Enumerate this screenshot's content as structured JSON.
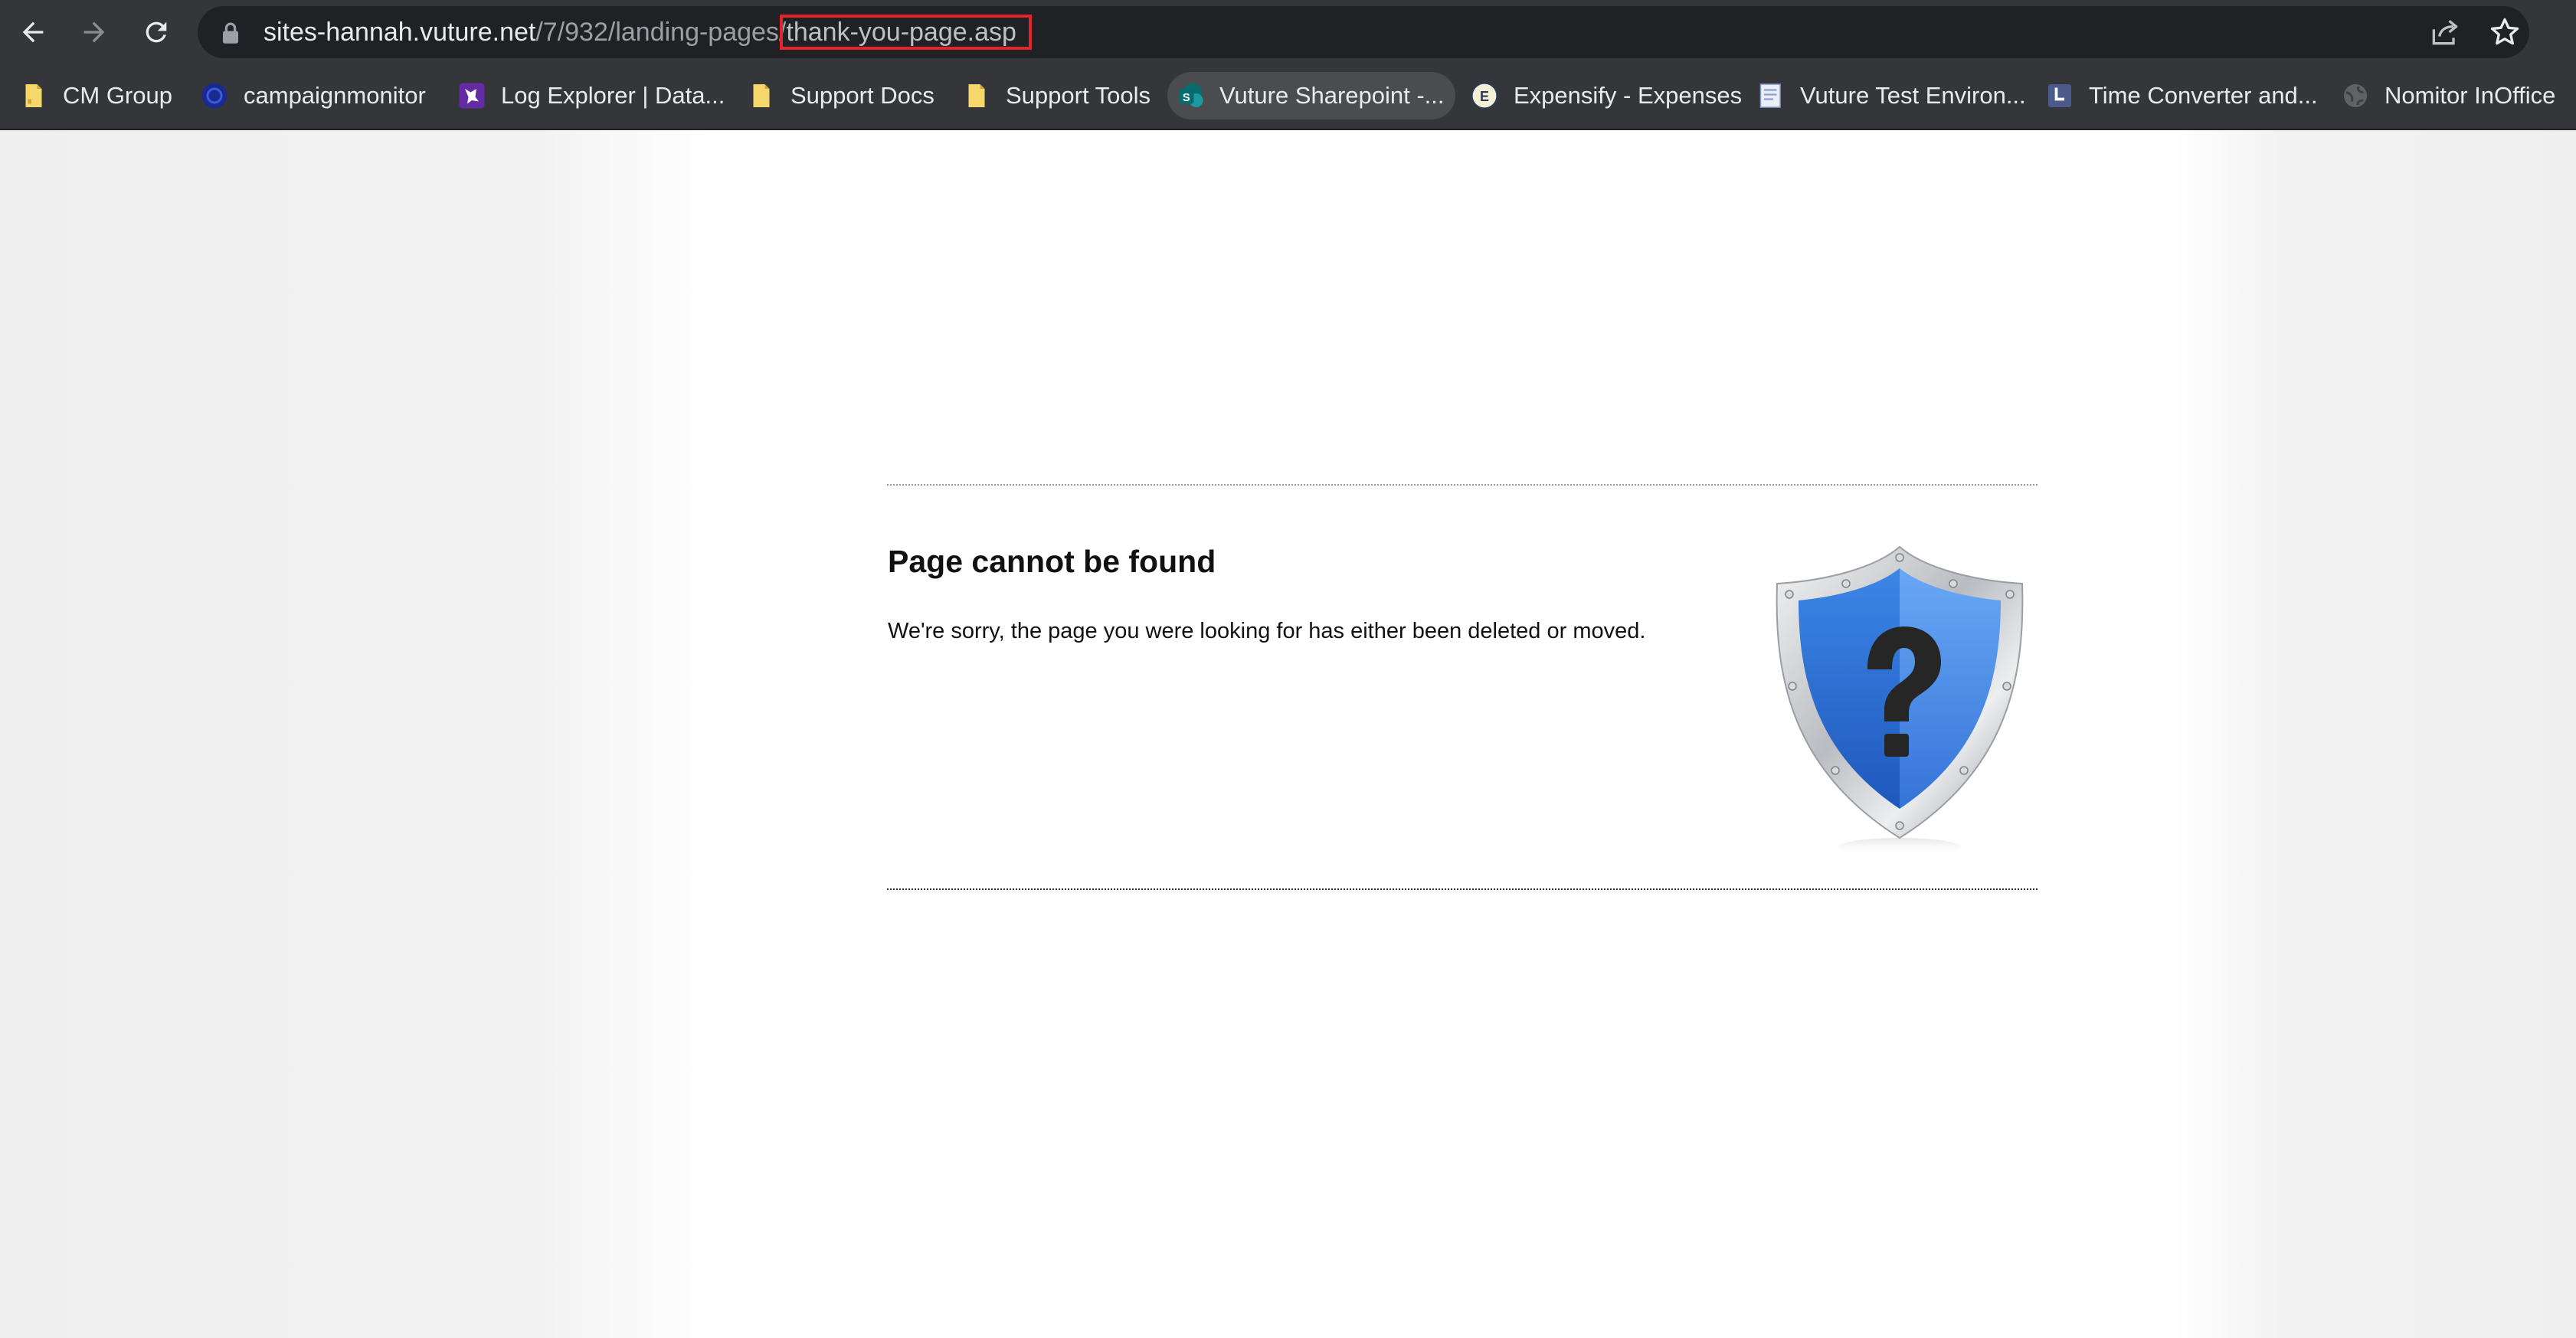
{
  "browser": {
    "url": {
      "host": "sites-hannah.vuture.net",
      "path": "/7/932/landing-pages/",
      "highlighted": "thank-you-page.asp"
    },
    "buttons": {
      "back": "back-arrow-icon",
      "forward": "forward-arrow-icon",
      "reload": "reload-icon",
      "share": "share-icon",
      "bookmark": "star-icon"
    }
  },
  "bookmarks": [
    {
      "label": "CM Group",
      "icon": "folder-icon"
    },
    {
      "label": "campaignmonitor",
      "icon": "campaignmonitor-icon"
    },
    {
      "label": "Log Explorer | Data...",
      "icon": "datadog-icon"
    },
    {
      "label": "Support Docs",
      "icon": "folder-icon"
    },
    {
      "label": "Support Tools",
      "icon": "folder-icon"
    },
    {
      "label": "Vuture Sharepoint -...",
      "icon": "sharepoint-icon"
    },
    {
      "label": "Expensify - Expenses",
      "icon": "expensify-icon"
    },
    {
      "label": "Vuture Test Environ...",
      "icon": "document-icon"
    },
    {
      "label": "Time Converter and...",
      "icon": "clock-icon"
    },
    {
      "label": "Nomitor InOffice",
      "icon": "globe-icon"
    }
  ],
  "page": {
    "title": "Page cannot be found",
    "message": "We're sorry, the page you were looking for has either been deleted or moved.",
    "image": "shield-question-icon"
  },
  "colors": {
    "chrome": "#35363a",
    "omnibox": "#202124",
    "highlight_box": "#e3242b",
    "shield_blue": "#2f6fd6"
  }
}
